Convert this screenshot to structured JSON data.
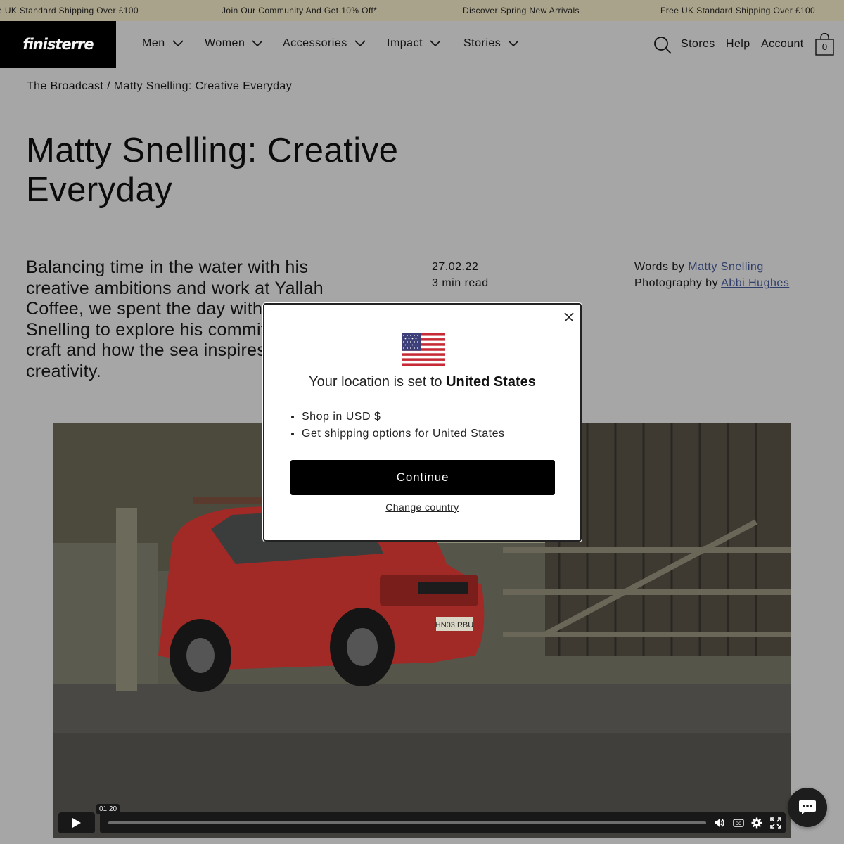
{
  "announcement": {
    "items": [
      "UK Standard Shipping Over £100",
      "Join Our Community And Get 10% Off*",
      "Discover Spring New Arrivals",
      "Free UK Standard Shipping Over £100"
    ],
    "prefix": "e"
  },
  "header": {
    "logo": "finisterre",
    "nav": [
      "Men",
      "Women",
      "Accessories",
      "Impact",
      "Stories"
    ],
    "utility": {
      "stores": "Stores",
      "help": "Help",
      "account": "Account"
    },
    "bag_count": "0"
  },
  "breadcrumb": "The Broadcast / Matty Snelling: Creative Everyday",
  "article": {
    "title": "Matty Snelling: Creative Everyday",
    "intro": "Balancing time in the water with his creative ambitions and work at Yallah Coffee, we spent the day with Matty Snelling to explore his commitment to craft and how the sea inspires his creativity.",
    "date": "27.02.22",
    "read_time": "3 min read",
    "words_prefix": "Words by",
    "words_author": "Matty Snelling",
    "photo_prefix": "Photography by",
    "photo_author": "Abbi Hughes"
  },
  "video": {
    "timestamp": "01:20",
    "plate": "HN03 RBU",
    "progress": 0.0
  },
  "modal": {
    "title_prefix": "Your location is set to",
    "country": "United States",
    "bullets": [
      "Shop in USD $",
      "Get shipping options for United States"
    ],
    "continue_label": "Continue",
    "change_label": "Change country"
  },
  "colors": {
    "announcement_bg": "#a9a38b",
    "page_bg": "#a6a6a6",
    "link": "#2f3e6b",
    "button": "#000000"
  },
  "icons": [
    "search-icon",
    "bag-icon",
    "chevron-down-icon",
    "close-icon",
    "flag-icon",
    "play-icon",
    "volume-icon",
    "captions-icon",
    "settings-icon",
    "fullscreen-icon",
    "chat-icon"
  ]
}
